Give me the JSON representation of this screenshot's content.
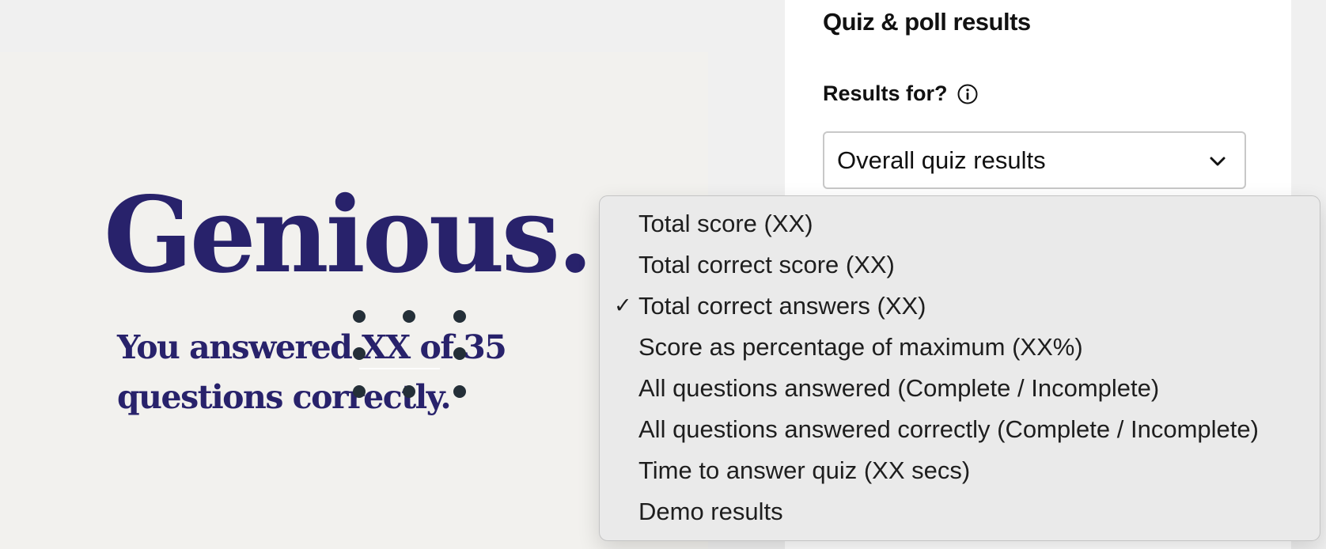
{
  "canvas": {
    "headline": "Genious.",
    "subline": "You answered XX of 35 questions correctly."
  },
  "panel": {
    "title": "Quiz & poll results",
    "field_label": "Results for?",
    "info_icon": "info-circle-icon",
    "select": {
      "value": "Overall quiz results",
      "chevron_icon": "chevron-down-icon"
    }
  },
  "menu": {
    "check_glyph": "✓",
    "selected_index": 2,
    "items": [
      {
        "label": "Total score (XX)"
      },
      {
        "label": "Total correct score (XX)"
      },
      {
        "label": "Total correct answers (XX)"
      },
      {
        "label": "Score as percentage of maximum (XX%)"
      },
      {
        "label": "All questions answered (Complete / Incomplete)"
      },
      {
        "label": "All questions answered correctly (Complete / Incomplete)"
      },
      {
        "label": "Time to answer quiz (XX secs)"
      },
      {
        "label": "Demo results"
      }
    ]
  },
  "colors": {
    "headline": "#28226b",
    "canvas_bg": "#f2f1ee",
    "handle": "#242f38",
    "menu_bg": "#eaeaea"
  }
}
